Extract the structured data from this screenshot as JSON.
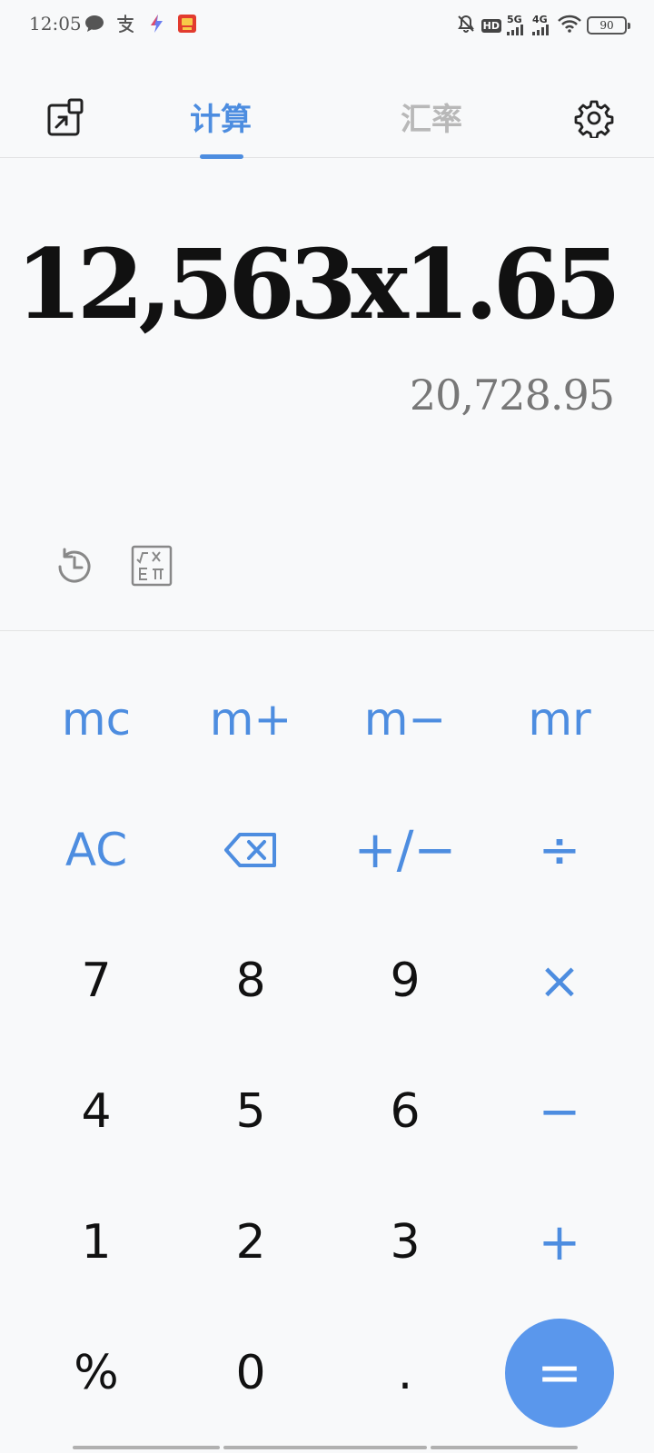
{
  "status_bar": {
    "time": "12:05",
    "notification_icons": [
      "chat-bubble-icon",
      "alipay-icon",
      "bolt-app-icon",
      "shopping-app-icon"
    ],
    "network_5g": "5G",
    "network_4g": "4G",
    "hd_badge": "HD",
    "battery_level": "90"
  },
  "header": {
    "tabs": [
      {
        "label": "计算",
        "active": true
      },
      {
        "label": "汇率",
        "active": false
      }
    ],
    "accent_color": "#4d8de0"
  },
  "display": {
    "expression": "12,563x1.65",
    "result": "20,728.95"
  },
  "keypad": {
    "rows": [
      [
        {
          "label": "mc"
        },
        {
          "label": "m+"
        },
        {
          "label": "m−"
        },
        {
          "label": "mr"
        }
      ],
      [
        {
          "label": "AC"
        },
        {
          "label": "",
          "icon": "backspace-icon"
        },
        {
          "label": "+/−"
        },
        {
          "label": "÷"
        }
      ],
      [
        {
          "label": "7"
        },
        {
          "label": "8"
        },
        {
          "label": "9"
        },
        {
          "label": "×"
        }
      ],
      [
        {
          "label": "4"
        },
        {
          "label": "5"
        },
        {
          "label": "6"
        },
        {
          "label": "−"
        }
      ],
      [
        {
          "label": "1"
        },
        {
          "label": "2"
        },
        {
          "label": "3"
        },
        {
          "label": "+"
        }
      ],
      [
        {
          "label": "%"
        },
        {
          "label": "0"
        },
        {
          "label": "."
        },
        {
          "label": "="
        }
      ]
    ],
    "equals_color": "#5a97ec"
  }
}
